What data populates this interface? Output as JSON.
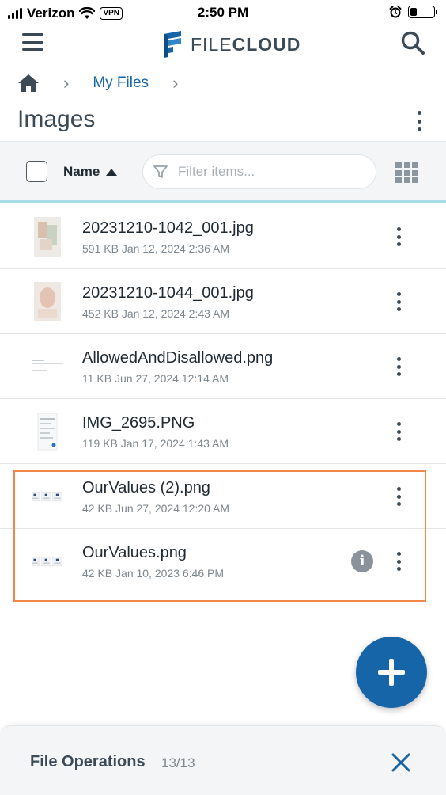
{
  "status_bar": {
    "carrier": "Verizon",
    "vpn": "VPN",
    "time": "2:50 PM",
    "battery_level": 0.28
  },
  "header": {
    "logo_text_light": "FILE",
    "logo_text_bold": "CLOUD",
    "logo_icon": "filecloud-logo-icon",
    "menu_icon": "hamburger-menu-icon",
    "search_icon": "search-icon"
  },
  "breadcrumb": {
    "home_icon": "home-icon",
    "items": [
      "My Files"
    ]
  },
  "page_title": "Images",
  "toolbar": {
    "sort_label": "Name",
    "sort_direction": "ascending",
    "filter_placeholder": "Filter items...",
    "filter_value": ""
  },
  "files": [
    {
      "name": "20231210-1042_001.jpg",
      "meta": "591 KB Jan 12, 2024 2:36 AM",
      "thumb": "photo",
      "info_icon": false
    },
    {
      "name": "20231210-1044_001.jpg",
      "meta": "452 KB Jan 12, 2024 2:43 AM",
      "thumb": "photo",
      "info_icon": false
    },
    {
      "name": "AllowedAndDisallowed.png",
      "meta": "11 KB Jun 27, 2024 12:14 AM",
      "thumb": "doc",
      "info_icon": false
    },
    {
      "name": "IMG_2695.PNG",
      "meta": "119 KB Jan 17, 2024 1:43 AM",
      "thumb": "screenshot",
      "info_icon": false
    },
    {
      "name": "OurValues (2).png",
      "meta": "42 KB Jun 27, 2024 12:20 AM",
      "thumb": "cards",
      "info_icon": false
    },
    {
      "name": "OurValues.png",
      "meta": "42 KB Jan 10, 2023 6:46 PM",
      "thumb": "cards",
      "info_icon": true
    }
  ],
  "file_operations": {
    "title": "File Operations",
    "count": "13/13"
  },
  "colors": {
    "accent": "#1565a8",
    "text_dark": "#3c4a55",
    "highlight": "#f0884a",
    "toolbar_bg": "#f4f5f6",
    "divider_accent": "#a9dde8"
  }
}
